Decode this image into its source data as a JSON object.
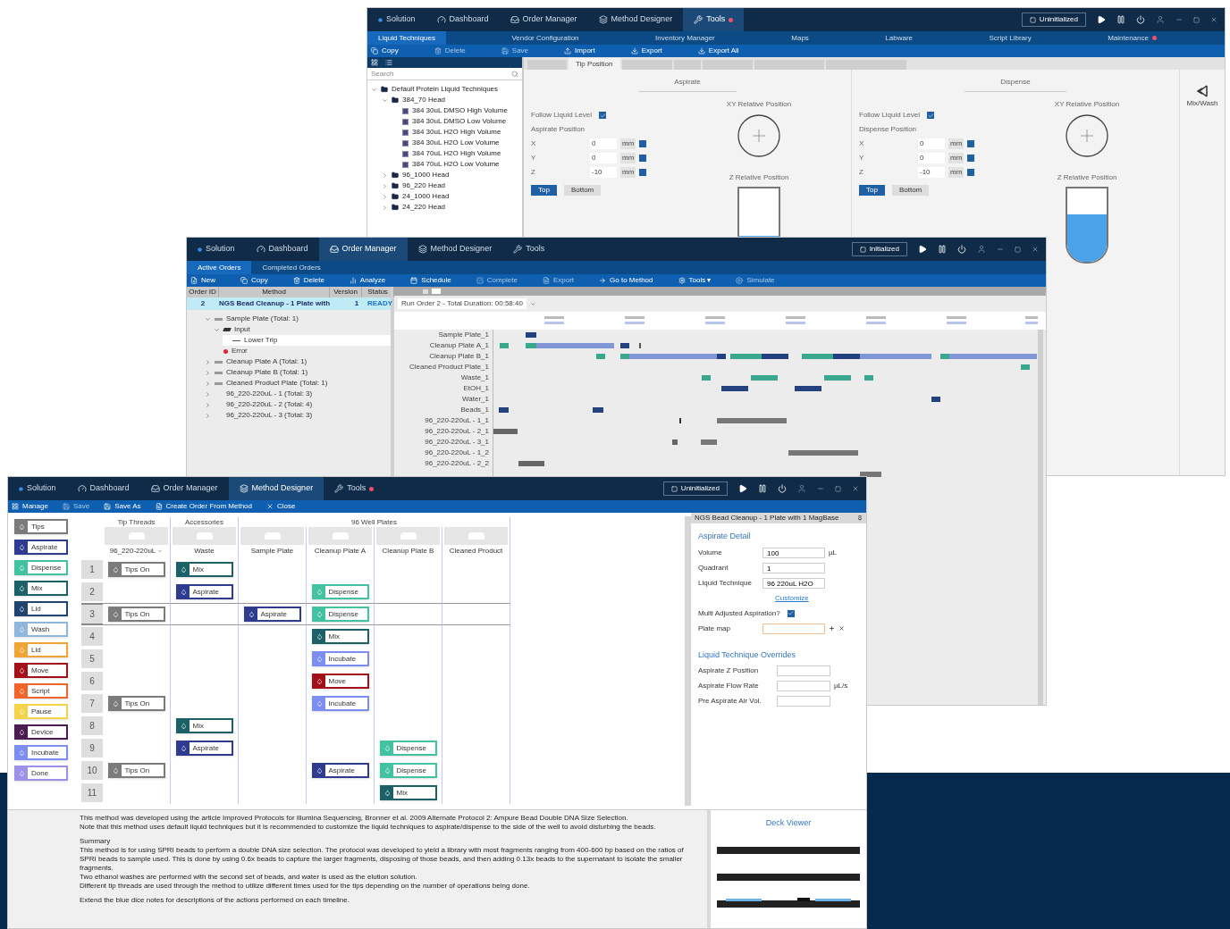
{
  "tools_window": {
    "nav": [
      {
        "label": "Solution",
        "selected": false,
        "alert": false
      },
      {
        "label": "Dashboard",
        "selected": false,
        "alert": false
      },
      {
        "label": "Order Manager",
        "selected": false,
        "alert": false
      },
      {
        "label": "Method Designer",
        "selected": false,
        "alert": false
      },
      {
        "label": "Tools",
        "selected": true,
        "alert": true
      }
    ],
    "status_button": "Uninitialized",
    "subtabs": [
      {
        "label": "Liquid Techniques",
        "selected": true,
        "alert": false
      },
      {
        "label": "Vendor Configuration",
        "selected": false,
        "alert": false
      },
      {
        "label": "Inventory Manager",
        "selected": false,
        "alert": false
      },
      {
        "label": "Maps",
        "selected": false,
        "alert": false
      },
      {
        "label": "Labware",
        "selected": false,
        "alert": false
      },
      {
        "label": "Script Library",
        "selected": false,
        "alert": false
      },
      {
        "label": "Maintenance",
        "selected": false,
        "alert": true
      }
    ],
    "toolbar": [
      {
        "label": "Copy",
        "disabled": false
      },
      {
        "label": "Delete",
        "disabled": true
      },
      {
        "label": "Save",
        "disabled": true
      },
      {
        "label": "Import",
        "disabled": false
      },
      {
        "label": "Export",
        "disabled": false
      },
      {
        "label": "Export All",
        "disabled": false
      }
    ],
    "search": {
      "placeholder": "Search"
    },
    "tree": [
      {
        "label": "Default Protein Liquid Techniques",
        "expanded": true,
        "children": [
          {
            "label": "384_70 Head",
            "expanded": true,
            "children": [
              {
                "label": "384 30uL DMSO High Volume"
              },
              {
                "label": "384 30uL DMSO Low Volume"
              },
              {
                "label": "384 30uL H2O High Volume"
              },
              {
                "label": "384 30uL H2O Low Volume"
              },
              {
                "label": "384 70uL H2O High Volume"
              },
              {
                "label": "384 70uL H2O Low Volume"
              }
            ]
          },
          {
            "label": "96_1000 Head",
            "expanded": false
          },
          {
            "label": "96_220 Head",
            "expanded": false
          },
          {
            "label": "24_1000 Head",
            "expanded": false
          },
          {
            "label": "24_220 Head",
            "expanded": false
          }
        ]
      }
    ],
    "detail_tab": "Tip Position",
    "panels": [
      {
        "title": "Aspirate",
        "follow_label": "Follow Liquid Level",
        "follow_checked": true,
        "position_label": "Aspirate Position",
        "axes": [
          {
            "axis": "X",
            "value": "0",
            "unit": "mm"
          },
          {
            "axis": "Y",
            "value": "0",
            "unit": "mm"
          },
          {
            "axis": "Z",
            "value": "-10",
            "unit": "mm"
          }
        ],
        "buttons": [
          {
            "label": "Top",
            "selected": true
          },
          {
            "label": "Bottom",
            "selected": false
          }
        ],
        "xy_label": "XY Relative Position",
        "z_label": "Z Relative Position",
        "level": 0.35
      },
      {
        "title": "Dispense",
        "follow_label": "Follow Liquid Level",
        "follow_checked": true,
        "position_label": "Dispense Position",
        "axes": [
          {
            "axis": "X",
            "value": "0",
            "unit": "mm"
          },
          {
            "axis": "Y",
            "value": "0",
            "unit": "mm"
          },
          {
            "axis": "Z",
            "value": "-10",
            "unit": "mm"
          }
        ],
        "buttons": [
          {
            "label": "Top",
            "selected": true
          },
          {
            "label": "Bottom",
            "selected": false
          }
        ],
        "xy_label": "XY Relative Position",
        "z_label": "Z Relative Position",
        "level": 0.65
      }
    ],
    "side_action": "Mix/Wash"
  },
  "order_window": {
    "nav": [
      {
        "label": "Solution",
        "selected": false,
        "alert": false
      },
      {
        "label": "Dashboard",
        "selected": false,
        "alert": false
      },
      {
        "label": "Order Manager",
        "selected": true,
        "alert": false
      },
      {
        "label": "Method Designer",
        "selected": false,
        "alert": false
      },
      {
        "label": "Tools",
        "selected": false,
        "alert": false
      }
    ],
    "status_button": "Initialized",
    "subtabs": [
      {
        "label": "Active Orders",
        "selected": true,
        "alert": false
      },
      {
        "label": "Completed Orders",
        "selected": false,
        "alert": false
      }
    ],
    "toolbar": [
      {
        "label": "New",
        "disabled": false
      },
      {
        "label": "Copy",
        "disabled": false
      },
      {
        "label": "Delete",
        "disabled": false
      },
      {
        "label": "Analyze",
        "disabled": false
      },
      {
        "label": "Schedule",
        "disabled": false
      },
      {
        "label": "Complete",
        "disabled": true
      },
      {
        "label": "Export",
        "disabled": true
      },
      {
        "label": "Go to Method",
        "disabled": false
      },
      {
        "label": "Tools ▾",
        "disabled": false
      },
      {
        "label": "Simulate",
        "disabled": true
      }
    ],
    "columns": [
      "Order ID",
      "Method",
      "Version",
      "Status"
    ],
    "order": {
      "cells": [
        "2",
        "NGS Bead Cleanup - 1 Plate with",
        "1",
        "READY"
      ],
      "selected": true
    },
    "tree": [
      {
        "label": "Sample Plate (Total: 1)",
        "kind": "plate",
        "selected": false,
        "expanded": true,
        "children": [
          {
            "label": "Input",
            "kind": "input",
            "selected": false,
            "expanded": true,
            "children": [
              {
                "label": "Lower Trip",
                "kind": "item",
                "selected": true
              }
            ]
          },
          {
            "label": "Error",
            "kind": "error",
            "selected": false
          }
        ]
      },
      {
        "label": "Cleanup Plate A (Total: 1)",
        "kind": "plate",
        "selected": false,
        "expanded": false
      },
      {
        "label": "Cleanup Plate B (Total: 1)",
        "kind": "plate",
        "selected": false,
        "expanded": false
      },
      {
        "label": "Cleaned Product Plate (Total: 1)",
        "kind": "plate",
        "selected": false,
        "expanded": false
      },
      {
        "label": "96_220-220uL - 1 (Total: 3)",
        "kind": "tips",
        "selected": false,
        "expanded": false
      },
      {
        "label": "96_220-220uL - 2 (Total: 4)",
        "kind": "tips",
        "selected": false,
        "expanded": false
      },
      {
        "label": "96_220-220uL - 3 (Total: 3)",
        "kind": "tips",
        "selected": false,
        "expanded": false
      }
    ],
    "run_title": "Run Order 2 - Total Duration: 00:58:40",
    "gantt_rows": [
      "Sample Plate_1",
      "Cleanup Plate A_1",
      "Cleanup Plate B_1",
      "Cleaned Product Plate_1",
      "Waste_1",
      "EtOH_1",
      "Water_1",
      "Beads_1",
      "96_220-220uL - 1_1",
      "96_220-220uL - 2_1",
      "96_220-220uL - 3_1",
      "96_220-220uL - 1_2",
      "96_220-220uL - 2_2"
    ]
  },
  "method_window": {
    "nav": [
      {
        "label": "Solution",
        "selected": false,
        "alert": false
      },
      {
        "label": "Dashboard",
        "selected": false,
        "alert": false
      },
      {
        "label": "Order Manager",
        "selected": false,
        "alert": false
      },
      {
        "label": "Method Designer",
        "selected": true,
        "alert": false
      },
      {
        "label": "Tools",
        "selected": false,
        "alert": true
      }
    ],
    "status_button": "Uninitialized",
    "toolbar": [
      {
        "label": "Manage",
        "disabled": false
      },
      {
        "label": "Save",
        "disabled": true
      },
      {
        "label": "Save As",
        "disabled": false
      },
      {
        "label": "Create Order From Method",
        "disabled": false
      },
      {
        "label": "Close",
        "disabled": false
      }
    ],
    "palette": [
      {
        "label": "Tips",
        "color": "#7b7b7b"
      },
      {
        "label": "Aspirate",
        "color": "#2f3b8f"
      },
      {
        "label": "Dispense",
        "color": "#43c2a2"
      },
      {
        "label": "Mix",
        "color": "#1d6168"
      },
      {
        "label": "Lid",
        "color": "#1f4470"
      },
      {
        "label": "Wash",
        "color": "#8fb6dc"
      },
      {
        "label": "Lid",
        "color": "#f0a435"
      },
      {
        "label": "Move",
        "color": "#a3101a"
      },
      {
        "label": "Script",
        "color": "#f2652a"
      },
      {
        "label": "Pause",
        "color": "#f5d44a"
      },
      {
        "label": "Device",
        "color": "#4b1b52"
      },
      {
        "label": "Incubate",
        "color": "#7d8ef2"
      },
      {
        "label": "Done",
        "color": "#9d90e8"
      }
    ],
    "groups": [
      {
        "label": "Tip Threads",
        "columns": [
          {
            "label": "96_220-220uL",
            "dropdown": true
          }
        ]
      },
      {
        "label": "Accessories",
        "columns": [
          {
            "label": "Waste",
            "dropdown": false
          }
        ]
      },
      {
        "label": "96 Well Plates",
        "columns": [
          {
            "label": "Sample Plate",
            "dropdown": false
          },
          {
            "label": "Cleanup Plate A",
            "dropdown": false
          },
          {
            "label": "Cleanup Plate B",
            "dropdown": false
          },
          {
            "label": "Cleaned Product",
            "dropdown": false
          }
        ]
      }
    ],
    "rows": [
      {
        "number": "1",
        "selected": false,
        "cells": [
          {
            "kind": "step",
            "label": "Tips On",
            "color": "#7b7b7b"
          },
          {
            "kind": "step",
            "label": "Mix",
            "color": "#1d6168"
          },
          {
            "kind": "empty"
          },
          {
            "kind": "empty"
          },
          {
            "kind": "empty"
          },
          {
            "kind": "empty"
          }
        ]
      },
      {
        "number": "2",
        "selected": false,
        "cells": [
          {
            "kind": "empty"
          },
          {
            "kind": "step",
            "label": "Aspirate",
            "color": "#2f3b8f"
          },
          {
            "kind": "empty"
          },
          {
            "kind": "step",
            "label": "Dispense",
            "color": "#43c2a2"
          },
          {
            "kind": "empty"
          },
          {
            "kind": "empty"
          }
        ]
      },
      {
        "number": "3",
        "selected": true,
        "cells": [
          {
            "kind": "step",
            "label": "Tips On",
            "color": "#7b7b7b"
          },
          {
            "kind": "empty"
          },
          {
            "kind": "step",
            "label": "Aspirate",
            "color": "#2f3b8f"
          },
          {
            "kind": "step",
            "label": "Dispense",
            "color": "#43c2a2"
          },
          {
            "kind": "empty"
          },
          {
            "kind": "empty"
          }
        ]
      },
      {
        "number": "4",
        "selected": false,
        "cells": [
          {
            "kind": "empty"
          },
          {
            "kind": "empty"
          },
          {
            "kind": "empty"
          },
          {
            "kind": "step",
            "label": "Mix",
            "color": "#1d6168"
          },
          {
            "kind": "empty"
          },
          {
            "kind": "empty"
          }
        ]
      },
      {
        "number": "5",
        "selected": false,
        "cells": [
          {
            "kind": "empty"
          },
          {
            "kind": "empty"
          },
          {
            "kind": "empty"
          },
          {
            "kind": "step",
            "label": "Incubate",
            "color": "#7d8ef2"
          },
          {
            "kind": "empty"
          },
          {
            "kind": "empty"
          }
        ]
      },
      {
        "number": "6",
        "selected": false,
        "cells": [
          {
            "kind": "empty"
          },
          {
            "kind": "empty"
          },
          {
            "kind": "empty"
          },
          {
            "kind": "step",
            "label": "Move",
            "color": "#a3101a"
          },
          {
            "kind": "empty"
          },
          {
            "kind": "empty"
          }
        ]
      },
      {
        "number": "7",
        "selected": false,
        "cells": [
          {
            "kind": "step",
            "label": "Tips On",
            "color": "#7b7b7b"
          },
          {
            "kind": "empty"
          },
          {
            "kind": "empty"
          },
          {
            "kind": "step",
            "label": "Incubate",
            "color": "#7d8ef2"
          },
          {
            "kind": "empty"
          },
          {
            "kind": "empty"
          }
        ]
      },
      {
        "number": "8",
        "selected": false,
        "cells": [
          {
            "kind": "empty"
          },
          {
            "kind": "step",
            "label": "Mix",
            "color": "#1d6168"
          },
          {
            "kind": "empty"
          },
          {
            "kind": "empty"
          },
          {
            "kind": "empty"
          },
          {
            "kind": "empty"
          }
        ]
      },
      {
        "number": "9",
        "selected": false,
        "cells": [
          {
            "kind": "empty"
          },
          {
            "kind": "step",
            "label": "Aspirate",
            "color": "#2f3b8f"
          },
          {
            "kind": "empty"
          },
          {
            "kind": "empty"
          },
          {
            "kind": "step",
            "label": "Dispense",
            "color": "#43c2a2"
          },
          {
            "kind": "empty"
          }
        ]
      },
      {
        "number": "10",
        "selected": false,
        "cells": [
          {
            "kind": "step",
            "label": "Tips On",
            "color": "#7b7b7b"
          },
          {
            "kind": "empty"
          },
          {
            "kind": "empty"
          },
          {
            "kind": "step",
            "label": "Aspirate",
            "color": "#2f3b8f"
          },
          {
            "kind": "step",
            "label": "Dispense",
            "color": "#43c2a2"
          },
          {
            "kind": "empty"
          }
        ]
      },
      {
        "number": "11",
        "selected": false,
        "cells": [
          {
            "kind": "empty"
          },
          {
            "kind": "empty"
          },
          {
            "kind": "empty"
          },
          {
            "kind": "empty"
          },
          {
            "kind": "step",
            "label": "Mix",
            "color": "#1d6168"
          },
          {
            "kind": "empty"
          }
        ]
      }
    ],
    "detail": {
      "header": "NGS Bead Cleanup - 1 Plate with 1 MagBase",
      "title": "Aspirate Detail",
      "fields": [
        {
          "label": "Volume",
          "value": "100",
          "unit": "µL"
        },
        {
          "label": "Quadrant",
          "value": "1"
        },
        {
          "label": "Liquid Technique",
          "value": "96 220uL H2O"
        }
      ],
      "link": "Customize",
      "check_label": "Multi Adjusted Aspiration?",
      "checked": true,
      "plate_map": "Plate map",
      "overrides_title": "Liquid Technique Overrides",
      "overrides": [
        {
          "label": "Aspirate Z Position"
        },
        {
          "label": "Aspirate Flow Rate",
          "unit": "µL/s"
        },
        {
          "label": "Pre Aspirate Air Vol."
        }
      ]
    },
    "description": [
      [
        "This method was developed using the article Improved Protocols for Illumina Sequencing, Bronner et al. 2009 Alternate Protocol 2: Ampure Bead Double DNA Size Selection.",
        "Note that this method uses default liquid techniques but it is recommended to customize the liquid techniques to aspirate/dispense to the side of the well to avoid disturbing the beads."
      ],
      [
        "Summary",
        "This method is for using SPRI beads to perform a double DNA size selection. The protocol was developed to yield a library with most fragments ranging from 400-600 bp based on the ratios of SPRI beads to sample used. This is done by using 0.6x beads to capture the larger fragments, disposing of those beads, and then adding 0.13x beads to the supernatant to isolate the smaller fragments.",
        "Two ethanol washes are performed with the second set of beads, and water is used as the elution solution.",
        "Different tip threads are used through the method to utilize different times used for the tips depending on the number of operations being done."
      ],
      [
        "Extend the blue dice notes for descriptions of the actions performed on each timeline."
      ]
    ],
    "deck_title": "Deck Viewer"
  }
}
